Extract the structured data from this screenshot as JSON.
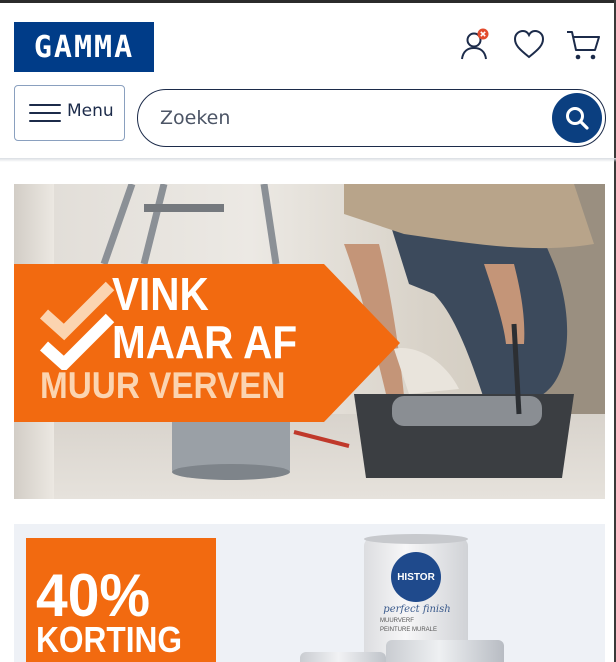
{
  "header": {
    "logo_text": "GAMMA",
    "menu_label": "Menu",
    "search_placeholder": "Zoeken",
    "icons": [
      "account-icon",
      "wishlist-heart-icon",
      "cart-icon",
      "search-icon"
    ]
  },
  "banners": {
    "muur": {
      "line1": "VINK",
      "line2": "MAAR AF",
      "line3": "MUUR VERVEN"
    },
    "korting": {
      "percent": "40%",
      "label": "KORTING",
      "brand": "HISTOR",
      "product": "perfect finish",
      "line1": "MUURVERF",
      "line2": "PEINTURE MURALE"
    }
  },
  "colors": {
    "brand_blue": "#003c88",
    "accent_orange": "#f26a10",
    "notification_red": "#e24a2c"
  }
}
